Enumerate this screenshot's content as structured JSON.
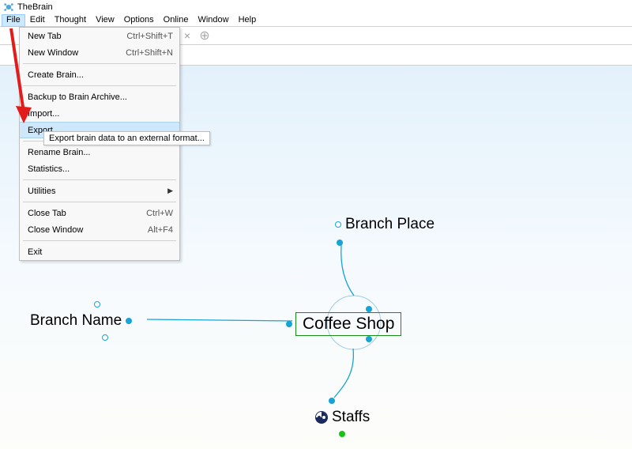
{
  "app": {
    "title": "TheBrain"
  },
  "menubar": [
    "File",
    "Edit",
    "Thought",
    "View",
    "Options",
    "Online",
    "Window",
    "Help"
  ],
  "dropdown": {
    "items": [
      {
        "label": "New Tab",
        "accel": "Ctrl+Shift+T"
      },
      {
        "label": "New Window",
        "accel": "Ctrl+Shift+N"
      },
      {
        "sep": true
      },
      {
        "label": "Create Brain..."
      },
      {
        "sep": true
      },
      {
        "label": "Backup to Brain Archive..."
      },
      {
        "label": "Import..."
      },
      {
        "label": "Export...",
        "highlight": true
      },
      {
        "sep": true
      },
      {
        "label": "Rename Brain..."
      },
      {
        "label": "Statistics..."
      },
      {
        "sep": true
      },
      {
        "label": "Utilities",
        "submenu": true
      },
      {
        "sep": true
      },
      {
        "label": "Close Tab",
        "accel": "Ctrl+W"
      },
      {
        "label": "Close Window",
        "accel": "Alt+F4"
      },
      {
        "sep": true
      },
      {
        "label": "Exit"
      }
    ]
  },
  "tooltip": "Export brain data to an external format...",
  "nodes": {
    "central": "Coffee Shop",
    "top": "Branch Place",
    "left": "Branch Name",
    "bottom": "Staffs"
  }
}
